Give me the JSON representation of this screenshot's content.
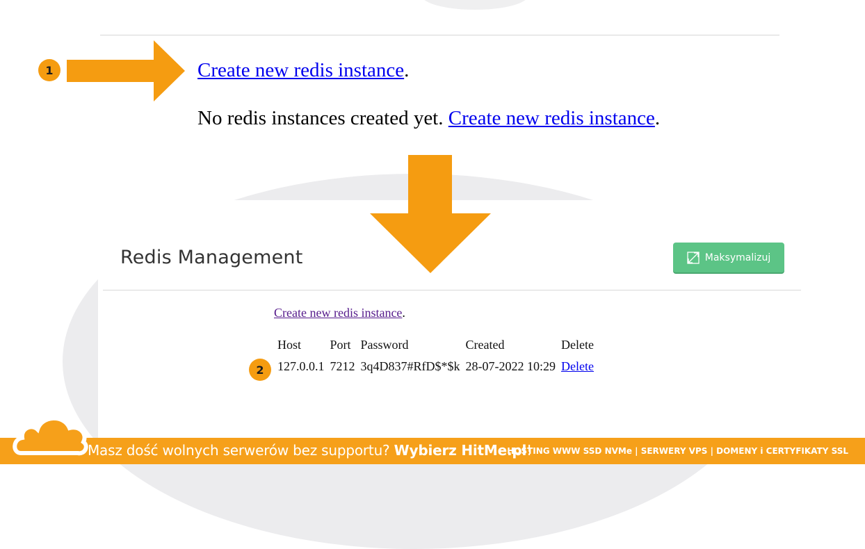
{
  "top": {
    "link_label": "Create new redis instance",
    "link_suffix": "."
  },
  "empty_state": {
    "message": "No redis instances created yet. ",
    "link_label": "Create new redis instance",
    "link_suffix": "."
  },
  "panel": {
    "title": "Redis Management",
    "maximize_label": "Maksymalizuj",
    "create_link_label": "Create new redis instance",
    "create_link_suffix": ".",
    "table": {
      "headers": [
        "Host",
        "Port",
        "Password",
        "Created",
        "Delete"
      ],
      "rows": [
        {
          "host": "127.0.0.1",
          "port": "7212",
          "password": "3q4D837#RfD$*$k",
          "created": "28-07-2022 10:29",
          "delete_label": "Delete"
        }
      ]
    }
  },
  "annotations": {
    "step1": "1",
    "step2": "2",
    "accent_color": "#f59c11"
  },
  "footer": {
    "tagline_prefix": "Masz dość wolnych serwerów bez supportu? ",
    "tagline_strong": "Wybierz HitMe.pl",
    "tagline_suffix": "!",
    "services": "HOSTING WWW SSD NVMe | SERWERY VPS | DOMENY i CERTYFIKATY SSL",
    "brand_color": "#f6a01a",
    "logo_icon": "cloud-icon"
  }
}
